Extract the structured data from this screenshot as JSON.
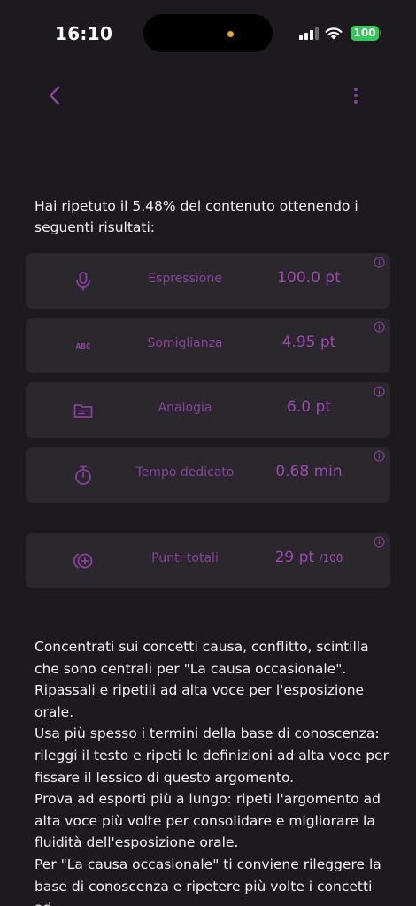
{
  "status_bar": {
    "time": "16:10",
    "battery": "100"
  },
  "intro": "Hai ripetuto il 5.48% del contenuto ottenendo i seguenti risultati:",
  "metrics": [
    {
      "label": "Espressione",
      "value": "100.0 pt",
      "icon": "microphone-icon"
    },
    {
      "label": "Somiglianza",
      "value": "4.95 pt",
      "icon": "abc-icon"
    },
    {
      "label": "Analogia",
      "value": "6.0 pt",
      "icon": "folder-icon"
    },
    {
      "label": "Tempo dedicato",
      "value": "0.68 min",
      "icon": "stopwatch-icon"
    }
  ],
  "total": {
    "label": "Punti totali",
    "value": "29 pt",
    "max": "/100",
    "icon": "plus-circle-icon"
  },
  "advice": [
    "Concentrati sui concetti causa, conflitto, scintilla che sono centrali per \"La causa occasionale\". Ripassali e ripetili ad alta voce per l'esposizione orale.",
    "Usa più spesso i termini della base di conoscenza: rileggi il testo e ripeti le definizioni ad alta voce per fissare il lessico di questo argomento.",
    "Prova ad esporti più a lungo: ripeti l'argomento ad alta voce più volte per consolidare e migliorare la fluidità dell'esposizione orale.",
    "Per \"La causa occasionale\" ti conviene rileggere la base di conoscenza e ripetere più volte i concetti ad"
  ],
  "colors": {
    "background": "#1c1a1e",
    "card": "#2a272d",
    "accent": "#9a4aad",
    "text": "#f2f2f2"
  }
}
